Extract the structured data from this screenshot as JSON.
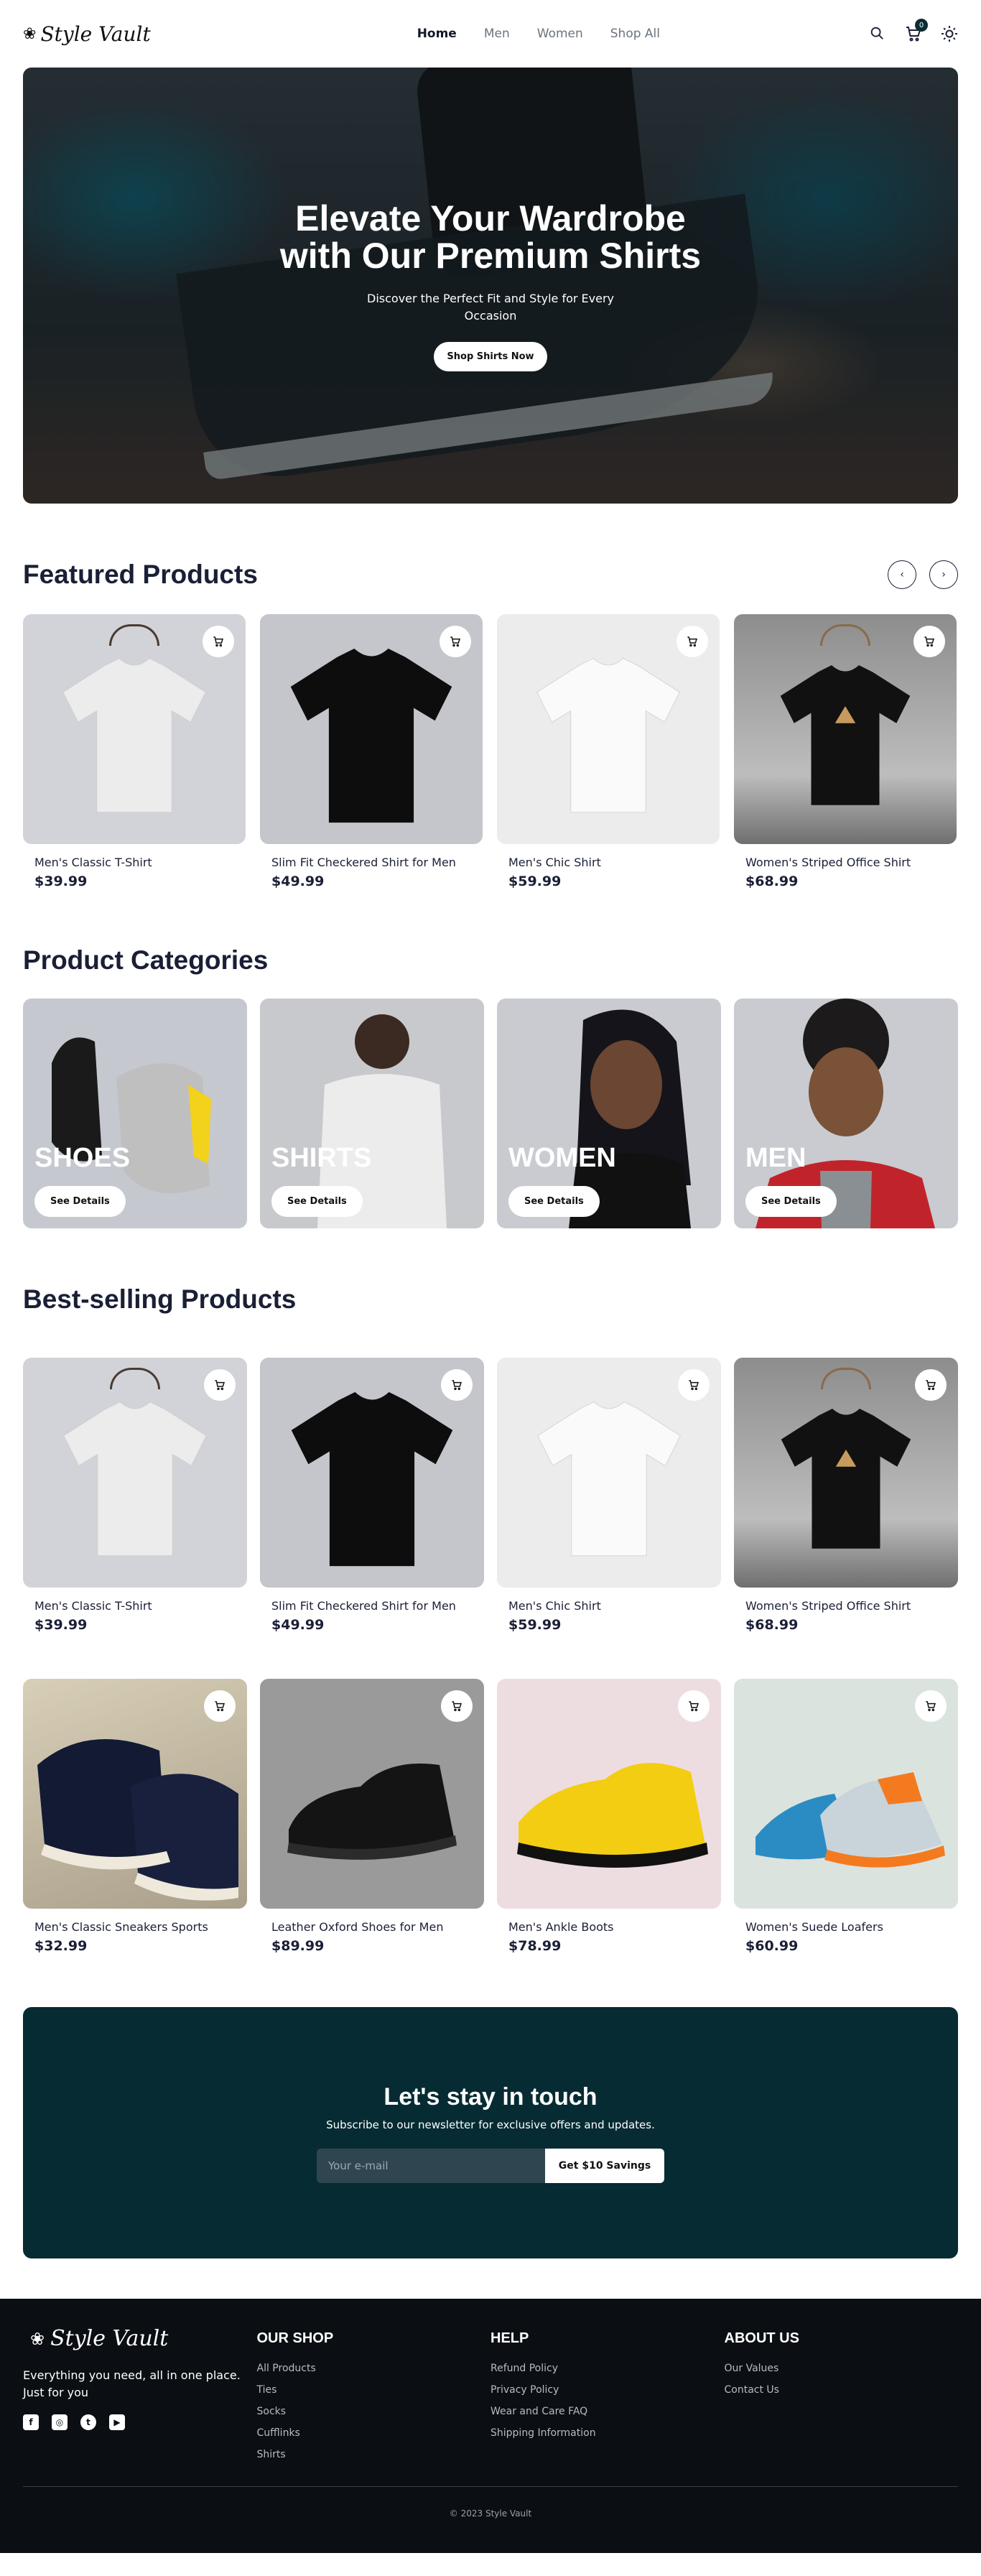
{
  "brand": {
    "name": "Style Vault"
  },
  "nav": {
    "home": "Home",
    "men": "Men",
    "women": "Women",
    "shop_all": "Shop All"
  },
  "cart": {
    "count": "0"
  },
  "hero": {
    "title": "Elevate Your Wardrobe with Our Premium Shirts",
    "subtitle": "Discover the Perfect Fit and Style for Every Occasion",
    "cta": "Shop Shirts Now"
  },
  "featured": {
    "title": "Featured Products",
    "products": [
      {
        "name": "Men's Classic T-Shirt",
        "price": "$39.99"
      },
      {
        "name": "Slim Fit Checkered Shirt for Men",
        "price": "$49.99"
      },
      {
        "name": "Men's Chic Shirt",
        "price": "$59.99"
      },
      {
        "name": "Women's Striped Office Shirt",
        "price": "$68.99"
      }
    ]
  },
  "categories": {
    "title": "Product Categories",
    "button": "See Details",
    "items": [
      {
        "label": "SHOES"
      },
      {
        "label": "SHIRTS"
      },
      {
        "label": "WOMEN"
      },
      {
        "label": "MEN"
      }
    ]
  },
  "bestselling": {
    "title": "Best-selling Products",
    "products": [
      {
        "name": "Men's Classic T-Shirt",
        "price": "$39.99"
      },
      {
        "name": "Slim Fit Checkered Shirt for Men",
        "price": "$49.99"
      },
      {
        "name": "Men's Chic Shirt",
        "price": "$59.99"
      },
      {
        "name": "Women's Striped Office Shirt",
        "price": "$68.99"
      },
      {
        "name": "Men's Classic Sneakers Sports",
        "price": "$32.99"
      },
      {
        "name": "Leather Oxford Shoes for Men",
        "price": "$89.99"
      },
      {
        "name": "Men's Ankle Boots",
        "price": "$78.99"
      },
      {
        "name": "Women's Suede Loafers",
        "price": "$60.99"
      }
    ]
  },
  "newsletter": {
    "title": "Let's stay in touch",
    "subtitle": "Subscribe to our newsletter for exclusive offers and updates.",
    "placeholder": "Your e-mail",
    "button": "Get $10 Savings"
  },
  "footer": {
    "tagline": "Everything you need, all in one place. Just for you",
    "shop": {
      "title": "OUR SHOP",
      "links": [
        "All Products",
        "Ties",
        "Socks",
        "Cufflinks",
        "Shirts"
      ]
    },
    "help": {
      "title": "HELP",
      "links": [
        "Refund Policy",
        "Privacy Policy",
        "Wear and Care FAQ",
        "Shipping Information"
      ]
    },
    "about": {
      "title": "ABOUT US",
      "links": [
        "Our Values",
        "Contact Us"
      ]
    },
    "copyright": "© 2023 Style Vault"
  },
  "colors": {
    "accent": "#062b33",
    "text": "#1a1f36",
    "footer_bg": "#0b0f14"
  }
}
